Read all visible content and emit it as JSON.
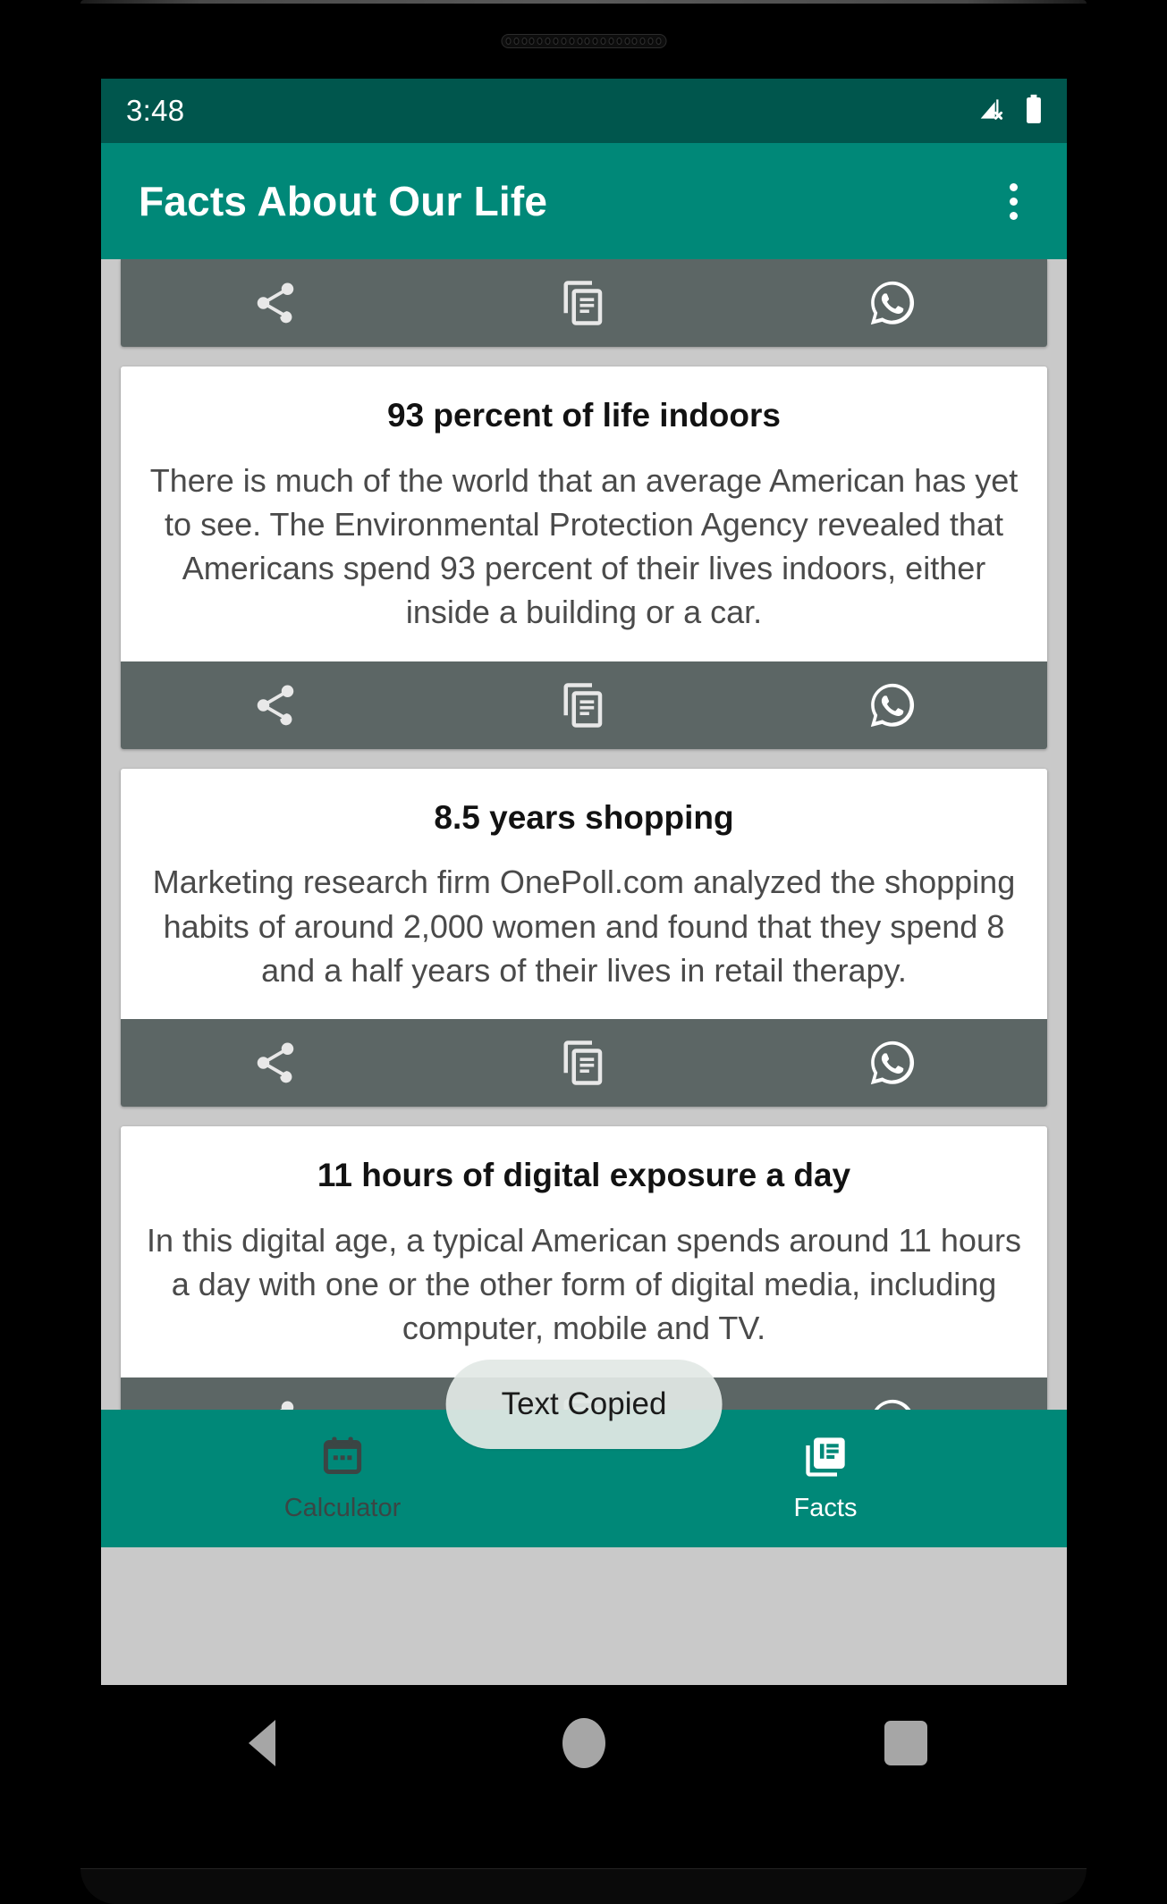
{
  "status_bar": {
    "time": "3:48",
    "icons": [
      "signal-off-icon",
      "battery-full-icon"
    ]
  },
  "app_bar": {
    "title": "Facts About Our Life",
    "overflow_label": "More options"
  },
  "colors": {
    "status_bar": "#00564d",
    "app_bar": "#008878",
    "accent": "#008878",
    "action_bar": "#5c6665",
    "page_background": "#c9c9c9",
    "card_background": "#ffffff",
    "toast_background": "#e2e8e5",
    "nav_selected": "#ffffff",
    "nav_unselected": "#3b4544"
  },
  "card_actions": {
    "share_label": "Share",
    "copy_label": "Copy",
    "whatsapp_label": "WhatsApp"
  },
  "cards": [
    {
      "partial": true,
      "title": "",
      "body": ""
    },
    {
      "partial": false,
      "title": "93 percent of life indoors",
      "body": "There is much of the world that an average American has yet to see. The Environmental Protection Agency revealed that Americans spend 93 percent of their lives indoors, either inside a building or a car."
    },
    {
      "partial": false,
      "title": "8.5 years shopping",
      "body": "Marketing research firm OnePoll.com analyzed the shopping habits of around 2,000 women and found that they spend 8 and a half years of their lives in retail therapy."
    },
    {
      "partial": false,
      "title": "11 hours of digital exposure a day",
      "body": "In this digital age, a typical American spends around 11 hours a day with one or the other form of digital media, including computer, mobile and TV."
    }
  ],
  "toast": {
    "message": "Text Copied"
  },
  "bottom_nav": {
    "items": [
      {
        "label": "Calculator",
        "icon": "calculator-icon",
        "selected": false
      },
      {
        "label": "Facts",
        "icon": "library-books-icon",
        "selected": true
      }
    ]
  },
  "android_nav": {
    "back_label": "Back",
    "home_label": "Home",
    "recents_label": "Recents"
  }
}
